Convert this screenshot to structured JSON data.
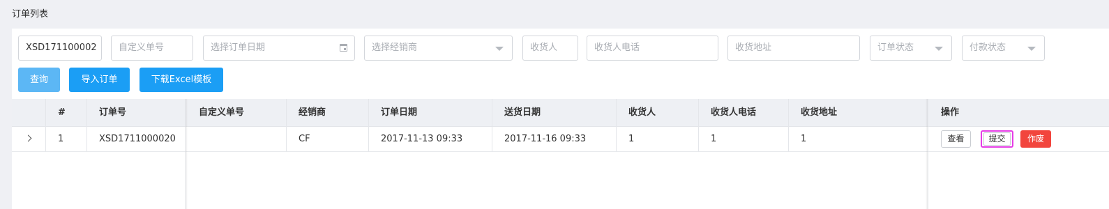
{
  "page": {
    "title": "订单列表"
  },
  "filters": {
    "order_no_value": "XSD171100002",
    "custom_no_placeholder": "自定义单号",
    "order_date_placeholder": "选择订单日期",
    "dealer_placeholder": "选择经销商",
    "receiver_placeholder": "收货人",
    "receiver_phone_placeholder": "收货人电话",
    "receiver_address_placeholder": "收货地址",
    "order_status_placeholder": "订单状态",
    "pay_status_placeholder": "付款状态"
  },
  "buttons": {
    "query": "查询",
    "import_orders": "导入订单",
    "download_template": "下载Excel模板"
  },
  "table": {
    "headers": {
      "index": "#",
      "order_no": "订单号",
      "custom_no": "自定义单号",
      "dealer": "经销商",
      "order_date": "订单日期",
      "delivery_date": "送货日期",
      "receiver": "收货人",
      "receiver_phone": "收货人电话",
      "receiver_address": "收货地址",
      "actions": "操作"
    },
    "rows": [
      {
        "index": "1",
        "order_no": "XSD1711000020",
        "custom_no": "",
        "dealer": "CF",
        "order_date": "2017-11-13 09:33",
        "delivery_date": "2017-11-16 09:33",
        "receiver": "1",
        "receiver_phone": "1",
        "receiver_address": "1",
        "actions": {
          "view": "查看",
          "submit": "提交",
          "void": "作废"
        }
      }
    ]
  },
  "colors": {
    "primary": "#1b9ef5",
    "danger": "#f2453d",
    "highlight": "#e63de6"
  }
}
